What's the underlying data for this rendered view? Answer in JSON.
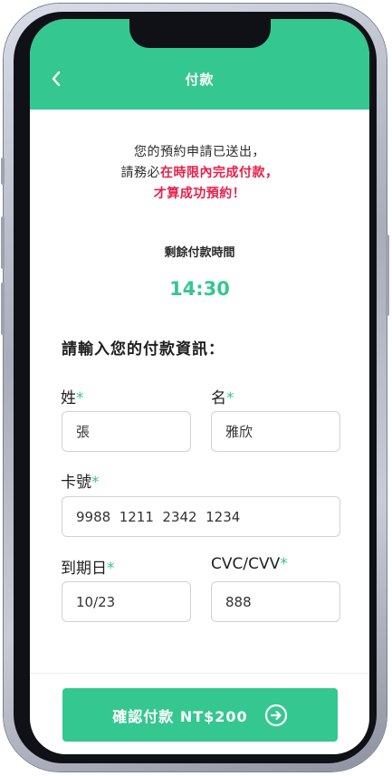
{
  "header": {
    "title": "付款",
    "back_icon": "chevron-left-icon"
  },
  "notice": {
    "line1": "您的預約申請已送出，",
    "line2_prefix": "請務必",
    "line2_highlight": "在時限內完成付款，",
    "line3": "才算成功預約！"
  },
  "countdown": {
    "label": "剩餘付款時間",
    "time": "14:30"
  },
  "form": {
    "title": "請輸入您的付款資訊：",
    "required_mark": "*",
    "last_name": {
      "label": "姓",
      "value": "張"
    },
    "first_name": {
      "label": "名",
      "value": "雅欣"
    },
    "card_number": {
      "label": "卡號",
      "value": "9988  1211  2342  1234"
    },
    "expiry": {
      "label": "到期日",
      "value": "10/23"
    },
    "cvc": {
      "label": "CVC/CVV",
      "value": "888"
    }
  },
  "confirm": {
    "label": "確認付款 NT$200",
    "icon": "arrow-right-circle-icon"
  },
  "colors": {
    "accent": "#35c790",
    "alert": "#e8204b"
  }
}
